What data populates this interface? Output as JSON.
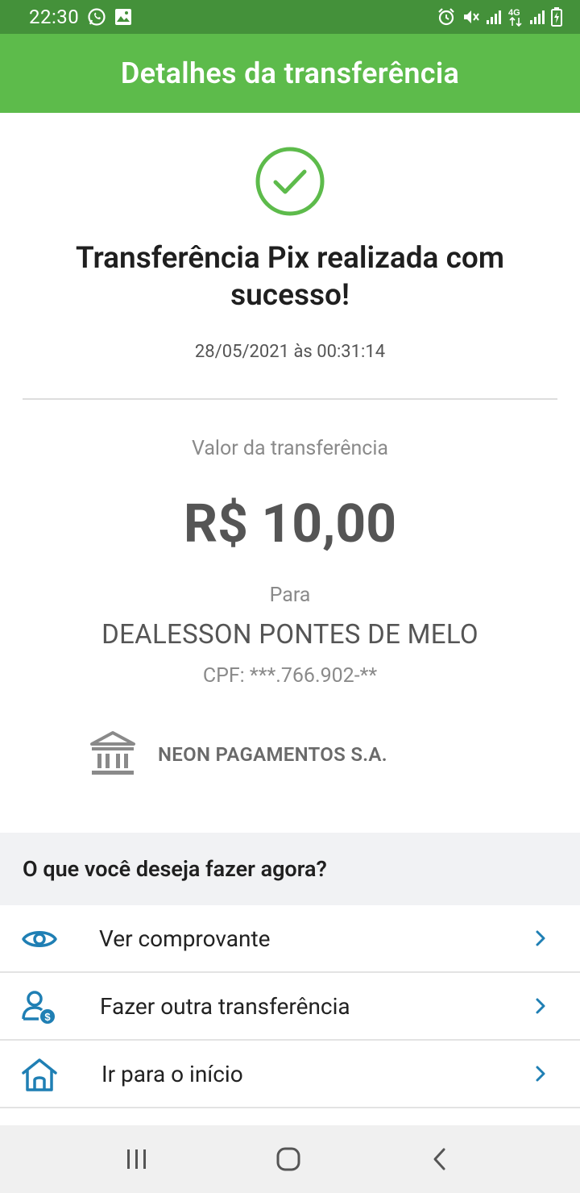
{
  "status_bar": {
    "time": "22:30",
    "left_icons": [
      "whatsapp-icon",
      "image-icon"
    ],
    "right_icons": [
      "alarm-icon",
      "mute-icon",
      "signal-icon",
      "4g-icon",
      "signal-icon",
      "battery-charging-icon"
    ],
    "network_label": "4G"
  },
  "app_bar": {
    "title": "Detalhes da transferência",
    "color": "#5dbb4b"
  },
  "receipt": {
    "success_icon": "check-circle-icon",
    "title": "Transferência Pix realizada com sucesso!",
    "timestamp": "28/05/2021 às 00:31:14",
    "amount_label": "Valor da transferência",
    "amount": "R$ 10,00",
    "to_label": "Para",
    "recipient_name": "DEALESSON PONTES DE MELO",
    "recipient_cpf": "CPF: ***.766.902-**",
    "bank_icon": "bank-icon",
    "bank_name": "NEON PAGAMENTOS S.A."
  },
  "actions": {
    "title": "O que você deseja fazer agora?",
    "accent_color": "#1f7fb4",
    "items": [
      {
        "label": "Ver comprovante",
        "icon": "eye-icon"
      },
      {
        "label": "Fazer outra transferência",
        "icon": "user-money-icon"
      },
      {
        "label": "Ir para o início",
        "icon": "home-icon"
      }
    ]
  },
  "nav_bar": {
    "buttons": [
      "recent-apps-icon",
      "home-button-icon",
      "back-icon"
    ]
  }
}
